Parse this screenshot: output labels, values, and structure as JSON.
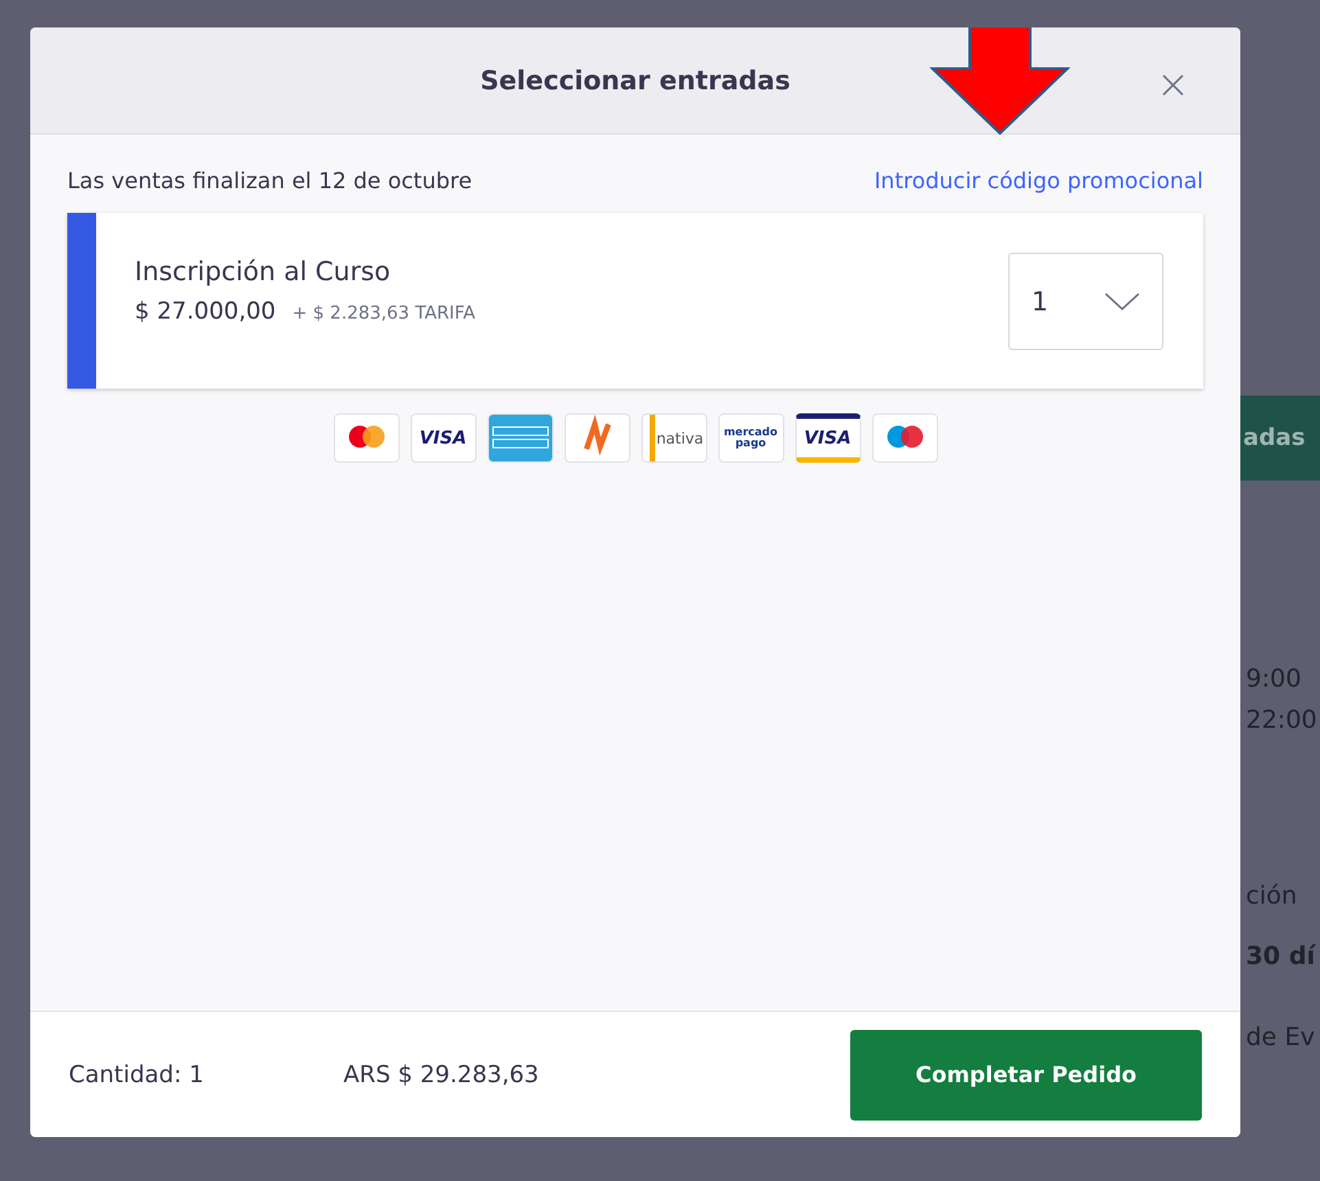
{
  "background_page": {
    "button_fragment": "adas",
    "fragments": [
      {
        "text": "9:00",
        "bold": false
      },
      {
        "text": "22:00",
        "bold": false
      },
      {
        "text": "ción",
        "bold": false
      },
      {
        "text": "30 dí",
        "bold": true
      },
      {
        "text": "de Ev",
        "bold": false
      }
    ]
  },
  "modal": {
    "title": "Seleccionar entradas",
    "sales_end": "Las ventas finalizan el 12 de octubre",
    "promo_link": "Introducir código promocional",
    "tickets": [
      {
        "name": "Inscripción al Curso",
        "price": "$ 27.000,00",
        "fee": "+ $ 2.283,63 TARIFA",
        "quantity": "1",
        "color": "#3659e3"
      }
    ],
    "payment_methods": [
      {
        "kind": "mastercard"
      },
      {
        "kind": "visa",
        "label": "VISA"
      },
      {
        "kind": "amex"
      },
      {
        "kind": "naranja"
      },
      {
        "kind": "nativa",
        "label": "nativa"
      },
      {
        "kind": "mercadopago",
        "label": "mercado pago"
      },
      {
        "kind": "visa-debit",
        "label": "VISA"
      },
      {
        "kind": "maestro"
      }
    ],
    "footer": {
      "quantity": "Cantidad: 1",
      "total": "ARS $ 29.283,63",
      "button": "Completar Pedido"
    }
  }
}
